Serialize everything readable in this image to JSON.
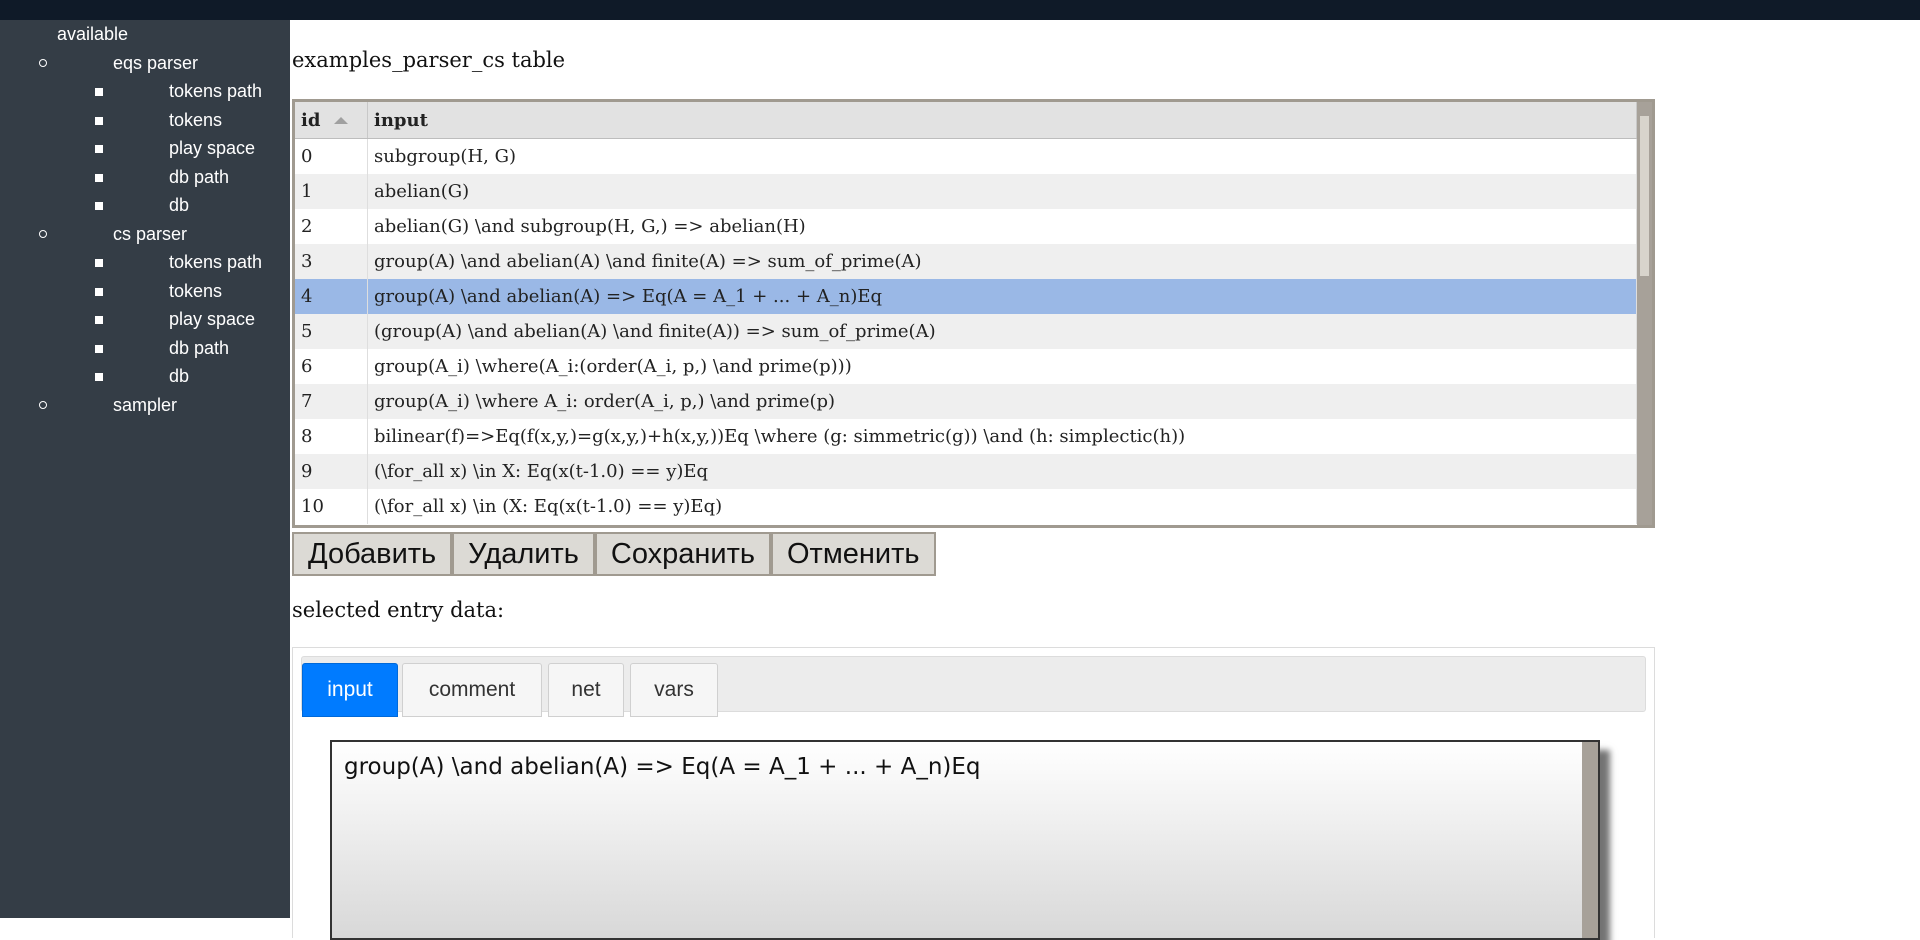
{
  "sidebar": {
    "root_label": "available",
    "groups": [
      {
        "label": "eqs parser",
        "items": [
          "tokens path",
          "tokens",
          "play space",
          "db path",
          "db"
        ]
      },
      {
        "label": "cs parser",
        "items": [
          "tokens path",
          "tokens",
          "play space",
          "db path",
          "db"
        ]
      },
      {
        "label": "sampler",
        "items": []
      }
    ]
  },
  "main": {
    "title": "examples_parser_cs table",
    "grid": {
      "columns": [
        "id",
        "input"
      ],
      "sort_column": "id",
      "selected_id": "4",
      "rows": [
        {
          "id": "0",
          "input": "subgroup(H, G)"
        },
        {
          "id": "1",
          "input": "abelian(G)"
        },
        {
          "id": "2",
          "input": "abelian(G) \\and subgroup(H, G,) => abelian(H)"
        },
        {
          "id": "3",
          "input": "group(A) \\and abelian(A) \\and finite(A) => sum_of_prime(A)"
        },
        {
          "id": "4",
          "input": "group(A) \\and abelian(A) => Eq(A = A_1 + ... + A_n)Eq"
        },
        {
          "id": "5",
          "input": "(group(A) \\and abelian(A) \\and finite(A)) => sum_of_prime(A)"
        },
        {
          "id": "6",
          "input": "group(A_i) \\where(A_i:(order(A_i, p,) \\and prime(p)))"
        },
        {
          "id": "7",
          "input": "group(A_i) \\where A_i: order(A_i, p,) \\and prime(p)"
        },
        {
          "id": "8",
          "input": "bilinear(f)=>Eq(f(x,y,)=g(x,y,)+h(x,y,))Eq \\where (g: simmetric(g)) \\and (h: simplectic(h))"
        },
        {
          "id": "9",
          "input": "(\\for_all x) \\in X: Eq(x(t-1.0) == y)Eq"
        },
        {
          "id": "10",
          "input": "(\\for_all x) \\in (X: Eq(x(t-1.0) == y)Eq)"
        }
      ]
    },
    "buttons": {
      "add": "Добавить",
      "delete": "Удалить",
      "save": "Сохранить",
      "cancel": "Отменить"
    },
    "selected_label": "selected entry data:",
    "tabs": [
      {
        "label": "input",
        "active": true
      },
      {
        "label": "comment",
        "active": false
      },
      {
        "label": "net",
        "active": false
      },
      {
        "label": "vars",
        "active": false
      }
    ],
    "editor_value": "group(A) \\and abelian(A) => Eq(A = A_1 + ... + A_n)Eq"
  }
}
